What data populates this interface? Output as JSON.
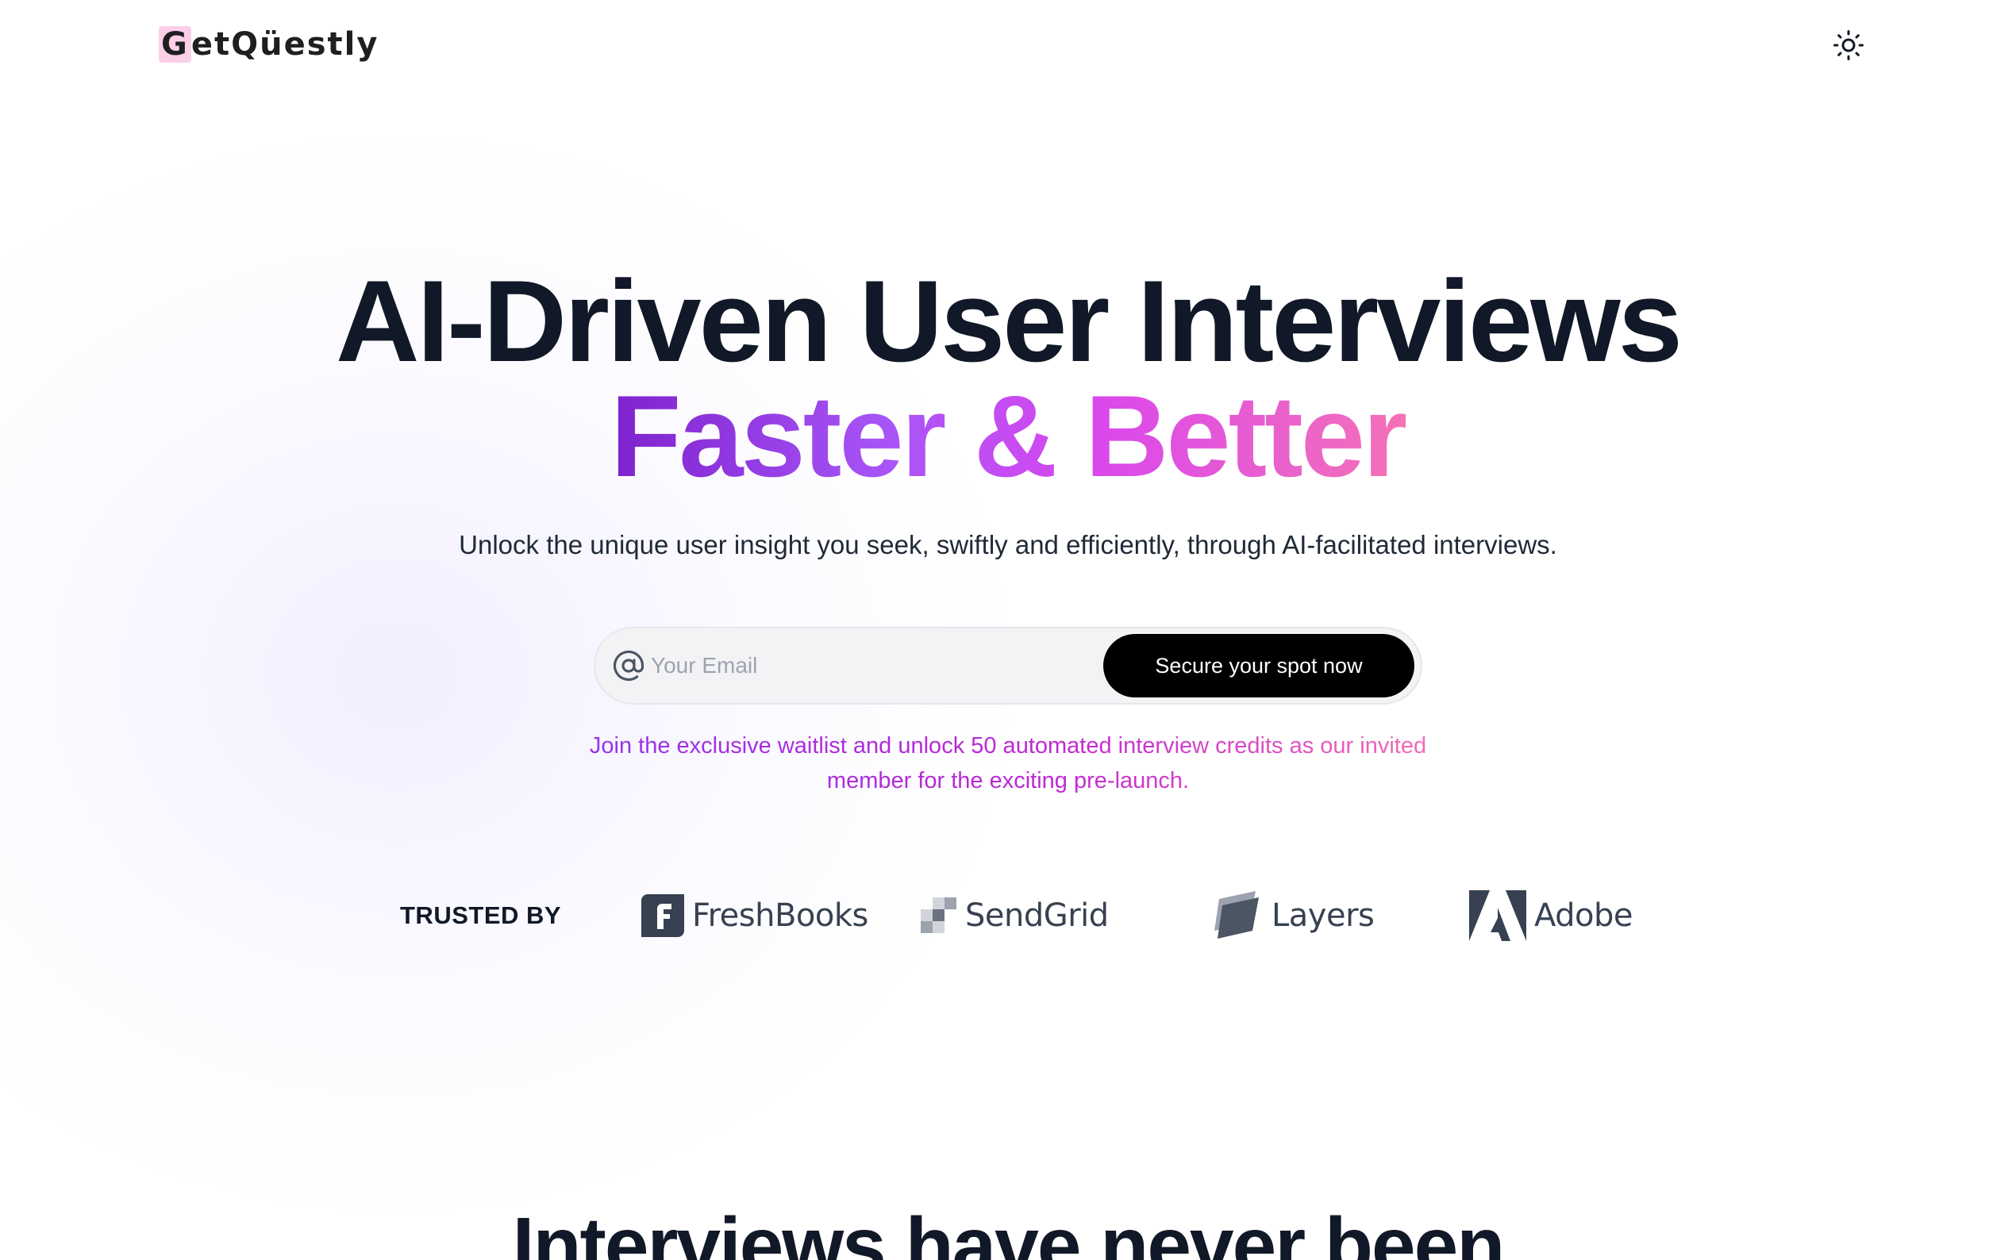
{
  "header": {
    "logo_first": "G",
    "logo_rest": "etQüestly",
    "theme_toggle_icon": "sun-icon"
  },
  "hero": {
    "line1": "AI-Driven User Interviews",
    "line2": "Faster & Better",
    "subtitle": "Unlock the unique user insight you seek, swiftly and efficiently, through AI-facilitated interviews."
  },
  "signup": {
    "email_icon": "at-icon",
    "email_placeholder": "Your Email",
    "email_value": "",
    "cta_label": "Secure your spot now",
    "note": "Join the exclusive waitlist and unlock 50 automated interview credits as our invited member for the exciting pre-launch."
  },
  "trusted": {
    "label": "TRUSTED BY",
    "brands": [
      {
        "name": "FreshBooks",
        "icon": "freshbooks-logo-icon"
      },
      {
        "name": "SendGrid",
        "icon": "sendgrid-logo-icon"
      },
      {
        "name": "Layers",
        "icon": "layers-logo-icon"
      },
      {
        "name": "Adobe",
        "icon": "adobe-logo-icon"
      }
    ]
  },
  "next_section": {
    "heading": "Interviews have never been"
  },
  "colors": {
    "accent_gradient_start": "#7e22ce",
    "accent_gradient_end": "#f472b6",
    "cta_background": "#000000",
    "heading": "#111827"
  }
}
